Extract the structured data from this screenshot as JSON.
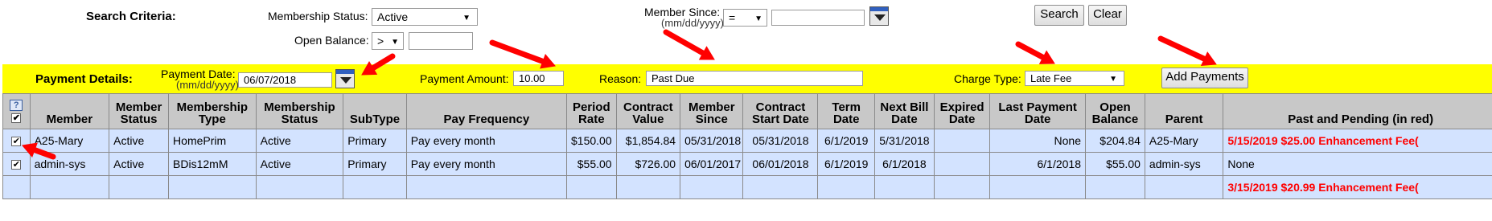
{
  "search": {
    "title": "Search Criteria:",
    "membership_status_label": "Membership Status:",
    "membership_status_value": "Active",
    "open_balance_label": "Open Balance:",
    "open_balance_operator": ">",
    "open_balance_value": "",
    "member_since_label": "Member Since:",
    "member_since_hint": "(mm/dd/yyyy)",
    "member_since_operator": "=",
    "member_since_value": "",
    "search_button": "Search",
    "clear_button": "Clear"
  },
  "payment": {
    "title": "Payment Details:",
    "date_label": "Payment Date:",
    "date_hint": "(mm/dd/yyyy)",
    "date_value": "06/07/2018",
    "amount_label": "Payment Amount:",
    "amount_value": "10.00",
    "reason_label": "Reason:",
    "reason_value": "Past Due",
    "charge_type_label": "Charge Type:",
    "charge_type_value": "Late Fee",
    "add_button": "Add Payments",
    "bar_color": "#ffff00"
  },
  "table": {
    "help_glyph": "?",
    "columns": [
      "Member",
      "Member Status",
      "Membership Type",
      "Membership Status",
      "SubType",
      "Pay Frequency",
      "Period Rate",
      "Contract Value",
      "Member Since",
      "Contract Start Date",
      "Term Date",
      "Next Bill Date",
      "Expired Date",
      "Last Payment Date",
      "Open Balance",
      "Parent",
      "Past and Pending (in red)"
    ],
    "rows": [
      [
        "A25-Mary",
        "Active",
        "HomePrim",
        "Active",
        "Primary",
        "Pay every month",
        "$150.00",
        "$1,854.84",
        "05/31/2018",
        "05/31/2018",
        "6/1/2019",
        "5/31/2018",
        "",
        "None",
        "$204.84",
        "A25-Mary",
        "5/15/2019 $25.00 Enhancement Fee("
      ],
      [
        "admin-sys",
        "Active",
        "BDis12mM",
        "Active",
        "Primary",
        "Pay every month",
        "$55.00",
        "$726.00",
        "06/01/2017",
        "06/01/2018",
        "6/1/2019",
        "6/1/2018",
        "",
        "6/1/2018",
        "$55.00",
        "admin-sys",
        "None"
      ],
      [
        "",
        "",
        "",
        "",
        "",
        "",
        "",
        "",
        "",
        "",
        "",
        "",
        "",
        "",
        "",
        "",
        "3/15/2019 $20.99 Enhancement Fee("
      ]
    ],
    "row_checked": [
      true,
      true,
      false
    ],
    "row_pending_red": [
      true,
      false,
      true
    ]
  },
  "annotation_color": "#ff0000"
}
